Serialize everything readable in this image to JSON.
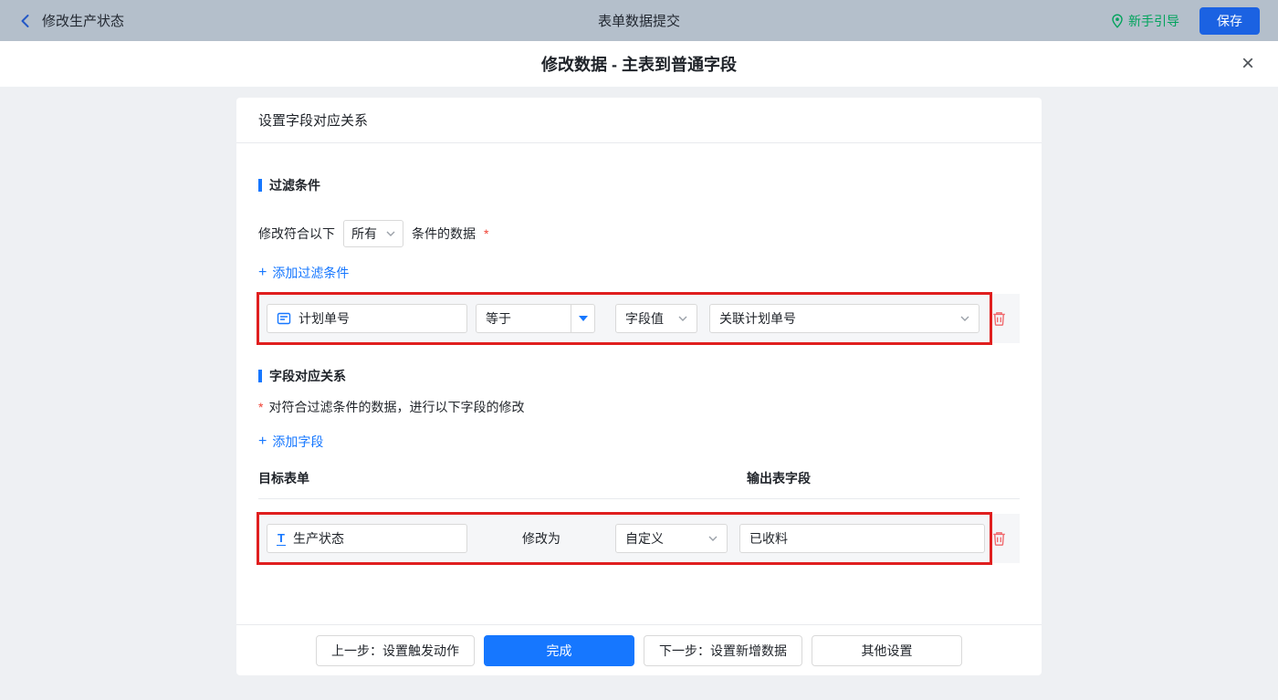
{
  "icons": {
    "plus": "+",
    "close": "×",
    "text_field": "T"
  },
  "topbar": {
    "back_title": "修改生产状态",
    "center_title": "表单数据提交",
    "guide": "新手引导",
    "save": "保存"
  },
  "modal": {
    "title": "修改数据 - 主表到普通字段",
    "panel_title": "设置字段对应关系",
    "filter": {
      "heading": "过滤条件",
      "condition_prefix": "修改符合以下",
      "condition_scope": "所有",
      "condition_suffix": "条件的数据",
      "required": "*",
      "add_label": "添加过滤条件",
      "row": {
        "field": "计划单号",
        "operator": "等于",
        "value_type": "字段值",
        "value_field": "关联计划单号"
      }
    },
    "mapping": {
      "heading": "字段对应关系",
      "required": "*",
      "description": "对符合过滤条件的数据，进行以下字段的修改",
      "add_label": "添加字段",
      "columns": {
        "target": "目标表单",
        "output": "输出表字段"
      },
      "row": {
        "field": "生产状态",
        "modify_label": "修改为",
        "mode": "自定义",
        "value": "已收料"
      }
    },
    "footer": {
      "prev": "上一步：设置触发动作",
      "done": "完成",
      "next": "下一步：设置新增数据",
      "other": "其他设置"
    }
  },
  "colors": {
    "accent_blue": "#1677ff",
    "annotation_red": "#e01f1f",
    "guide_green": "#00a35c",
    "delete_red": "#f0696d",
    "topbar_bg": "#b4bfcb"
  }
}
